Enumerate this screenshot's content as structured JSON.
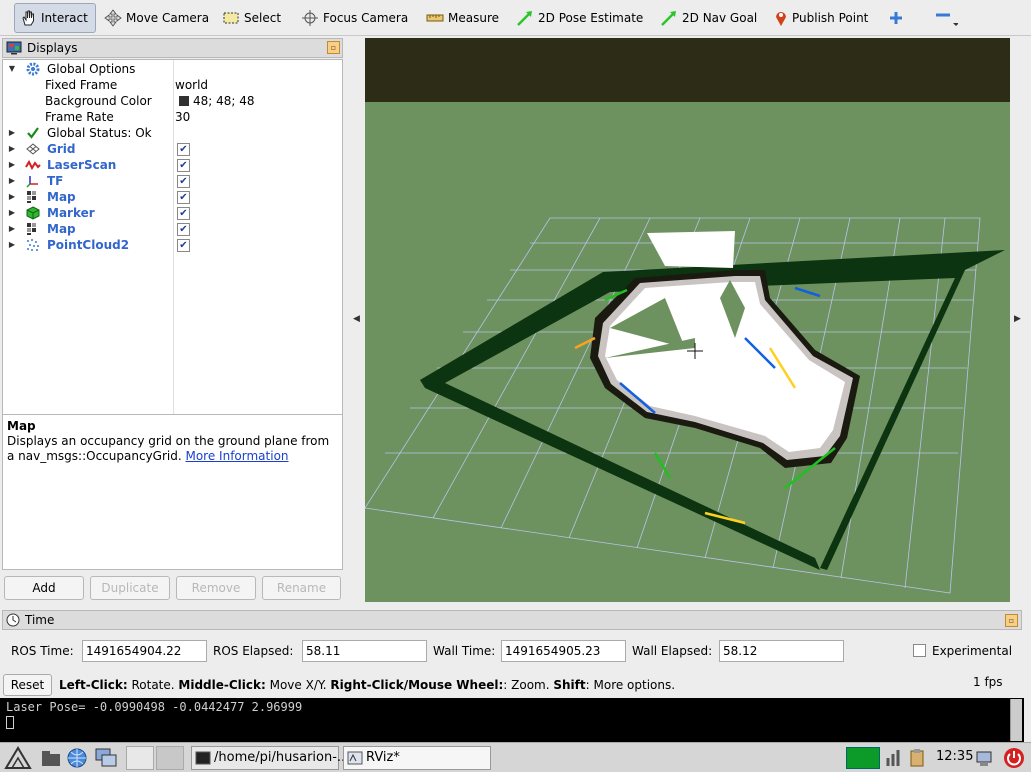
{
  "toolbar": {
    "items": [
      {
        "label": "Interact",
        "icon": "hand-icon"
      },
      {
        "label": "Move Camera",
        "icon": "move-camera-icon"
      },
      {
        "label": "Select",
        "icon": "select-icon"
      },
      {
        "label": "Focus Camera",
        "icon": "focus-camera-icon"
      },
      {
        "label": "Measure",
        "icon": "ruler-icon"
      },
      {
        "label": "2D Pose Estimate",
        "icon": "pose-arrow-icon"
      },
      {
        "label": "2D Nav Goal",
        "icon": "nav-arrow-icon"
      },
      {
        "label": "Publish Point",
        "icon": "map-pin-icon"
      }
    ]
  },
  "displays": {
    "title": "Displays",
    "global_options": "Global Options",
    "fixed_frame_label": "Fixed Frame",
    "fixed_frame_value": "world",
    "bg_color_label": "Background Color",
    "bg_color_value": "48; 48; 48",
    "frame_rate_label": "Frame Rate",
    "frame_rate_value": "30",
    "global_status": "Global Status: Ok",
    "items": [
      {
        "label": "Grid",
        "checked": true
      },
      {
        "label": "LaserScan",
        "checked": true
      },
      {
        "label": "TF",
        "checked": true
      },
      {
        "label": "Map",
        "checked": true
      },
      {
        "label": "Marker",
        "checked": true
      },
      {
        "label": "Map",
        "checked": true
      },
      {
        "label": "PointCloud2",
        "checked": true
      }
    ],
    "description": {
      "title": "Map",
      "text": "Displays an occupancy grid on the ground plane from a nav_msgs::OccupancyGrid.",
      "link": "More Information"
    },
    "buttons": {
      "add": "Add",
      "duplicate": "Duplicate",
      "remove": "Remove",
      "rename": "Rename"
    }
  },
  "time": {
    "title": "Time",
    "ros_time_label": "ROS Time:",
    "ros_time": "1491654904.22",
    "ros_elapsed_label": "ROS Elapsed:",
    "ros_elapsed": "58.11",
    "wall_time_label": "Wall Time:",
    "wall_time": "1491654905.23",
    "wall_elapsed_label": "Wall Elapsed:",
    "wall_elapsed": "58.12",
    "experimental": "Experimental",
    "reset": "Reset",
    "help": {
      "left_key": "Left-Click:",
      "left_val": " Rotate. ",
      "middle_key": "Middle-Click:",
      "middle_val": " Move X/Y. ",
      "right_key": "Right-Click/Mouse Wheel:",
      "right_val": ": Zoom. ",
      "shift_key": "Shift",
      "shift_val": ": More options."
    },
    "fps": "1 fps"
  },
  "terminal": {
    "line": "Laser Pose= -0.0990498 -0.0442477 2.96999"
  },
  "taskbar": {
    "task1": "/home/pi/husarion-...",
    "task2": "RViz*",
    "clock": "12:35"
  },
  "colors": {
    "ground": "#6e9160",
    "sky": "#2d2c17",
    "wall": "#0c3410",
    "accent": "#3366cc"
  }
}
